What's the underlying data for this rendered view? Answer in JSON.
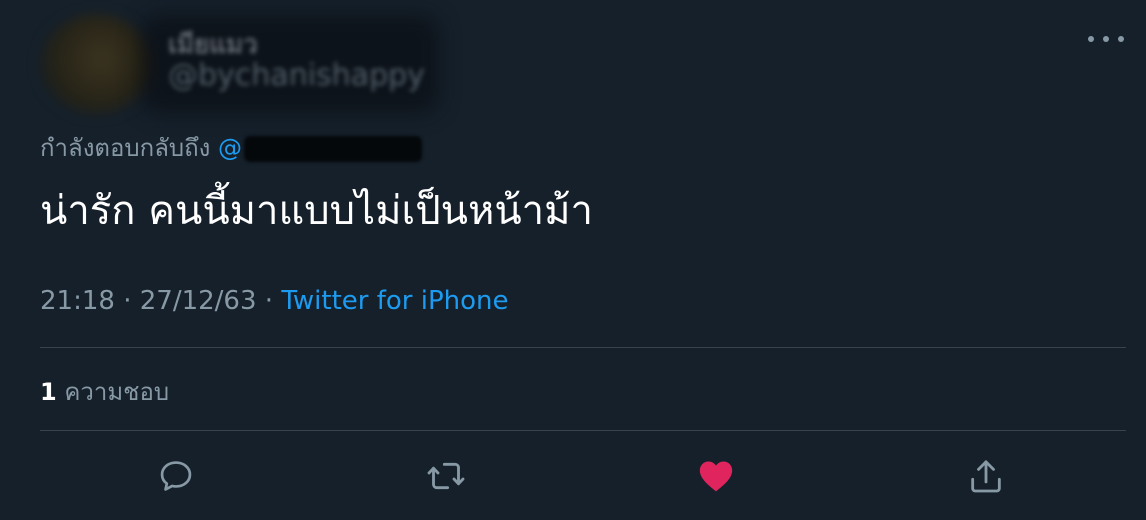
{
  "author": {
    "display_name": "เมียแมว",
    "handle": "@bychanishappy"
  },
  "reply_context": {
    "prefix": "กำลังตอบกลับถึง",
    "mention_at": "@"
  },
  "tweet": {
    "text": "น่ารัก คนนี้มาแบบไม่เป็นหน้าม้า",
    "time": "21:18",
    "date": "27/12/63",
    "separator": "·",
    "source": "Twitter for iPhone"
  },
  "stats": {
    "likes_count": "1",
    "likes_label": "ความชอบ"
  },
  "colors": {
    "background": "#15202b",
    "link": "#1d9bf0",
    "muted": "#8899a6",
    "divider": "#38444d",
    "like_active": "#e0245e"
  },
  "icons": {
    "more": "more-horizontal-icon",
    "reply": "reply-bubble-icon",
    "retweet": "retweet-icon",
    "like": "heart-filled-icon",
    "share": "share-upload-icon"
  }
}
